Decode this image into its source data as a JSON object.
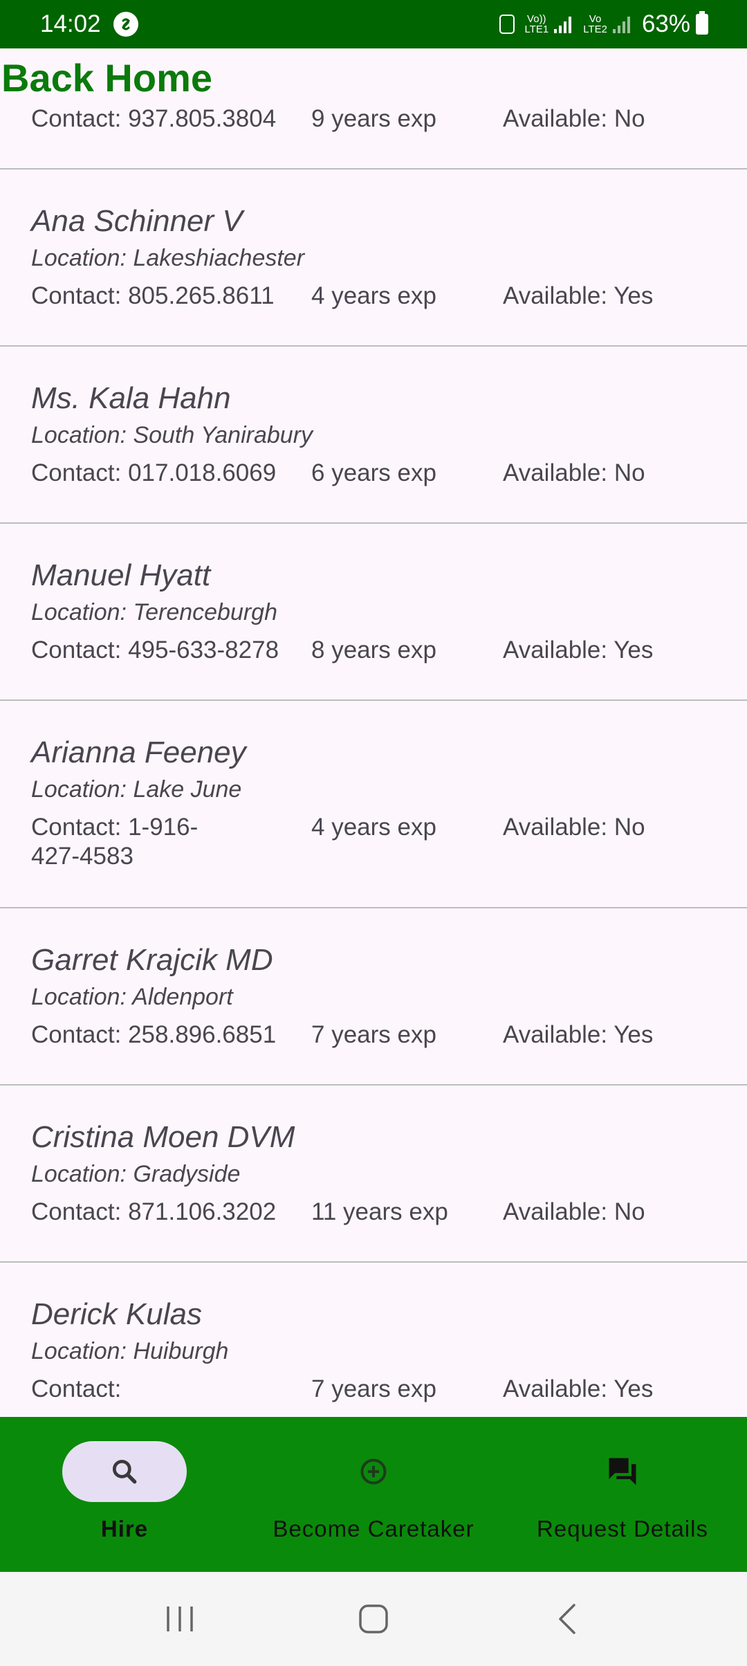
{
  "status_bar": {
    "time": "14:02",
    "net_top_1": "Vo))",
    "net_bottom_1": "LTE1",
    "net_top_2": "Vo",
    "net_bottom_2": "LTE2",
    "battery": "63%"
  },
  "header": {
    "back_label": "Back Home"
  },
  "caretakers": [
    {
      "name": "",
      "location": "",
      "contact": "Contact: 937.805.3804",
      "experience": "9 years exp",
      "availability": "Available: No"
    },
    {
      "name": "Ana Schinner V",
      "location": "Location: Lakeshiachester",
      "contact": "Contact: 805.265.8611",
      "experience": "4 years exp",
      "availability": "Available: Yes"
    },
    {
      "name": "Ms. Kala Hahn",
      "location": "Location: South Yanirabury",
      "contact": "Contact: 017.018.6069",
      "experience": "6 years exp",
      "availability": "Available: No"
    },
    {
      "name": "Manuel Hyatt",
      "location": "Location: Terenceburgh",
      "contact": "Contact: 495-633-8278",
      "experience": "8 years exp",
      "availability": "Available: Yes"
    },
    {
      "name": "Arianna Feeney",
      "location": "Location: Lake June",
      "contact": "Contact: 1-916-427-4583",
      "experience": "4 years exp",
      "availability": "Available: No"
    },
    {
      "name": "Garret Krajcik MD",
      "location": "Location: Aldenport",
      "contact": "Contact: 258.896.6851",
      "experience": "7 years exp",
      "availability": "Available: Yes"
    },
    {
      "name": "Cristina Moen DVM",
      "location": "Location: Gradyside",
      "contact": "Contact: 871.106.3202",
      "experience": "11 years exp",
      "availability": "Available: No"
    },
    {
      "name": "Derick Kulas",
      "location": "Location: Huiburgh",
      "contact": "Contact:",
      "experience": "7 years exp",
      "availability": "Available: Yes"
    }
  ],
  "bottom_nav": {
    "hire_label": "Hire",
    "become_label": "Become Caretaker",
    "request_label": "Request Details"
  },
  "icons": {
    "hire": "search-icon",
    "become": "add-circle-icon",
    "request": "forum-icon"
  },
  "colors": {
    "status_bar": "#006400",
    "accent_green": "#0b7a0b",
    "bottom_nav": "#0a8a0a",
    "active_pill": "#e6dff4",
    "background": "#fdf7fd"
  }
}
